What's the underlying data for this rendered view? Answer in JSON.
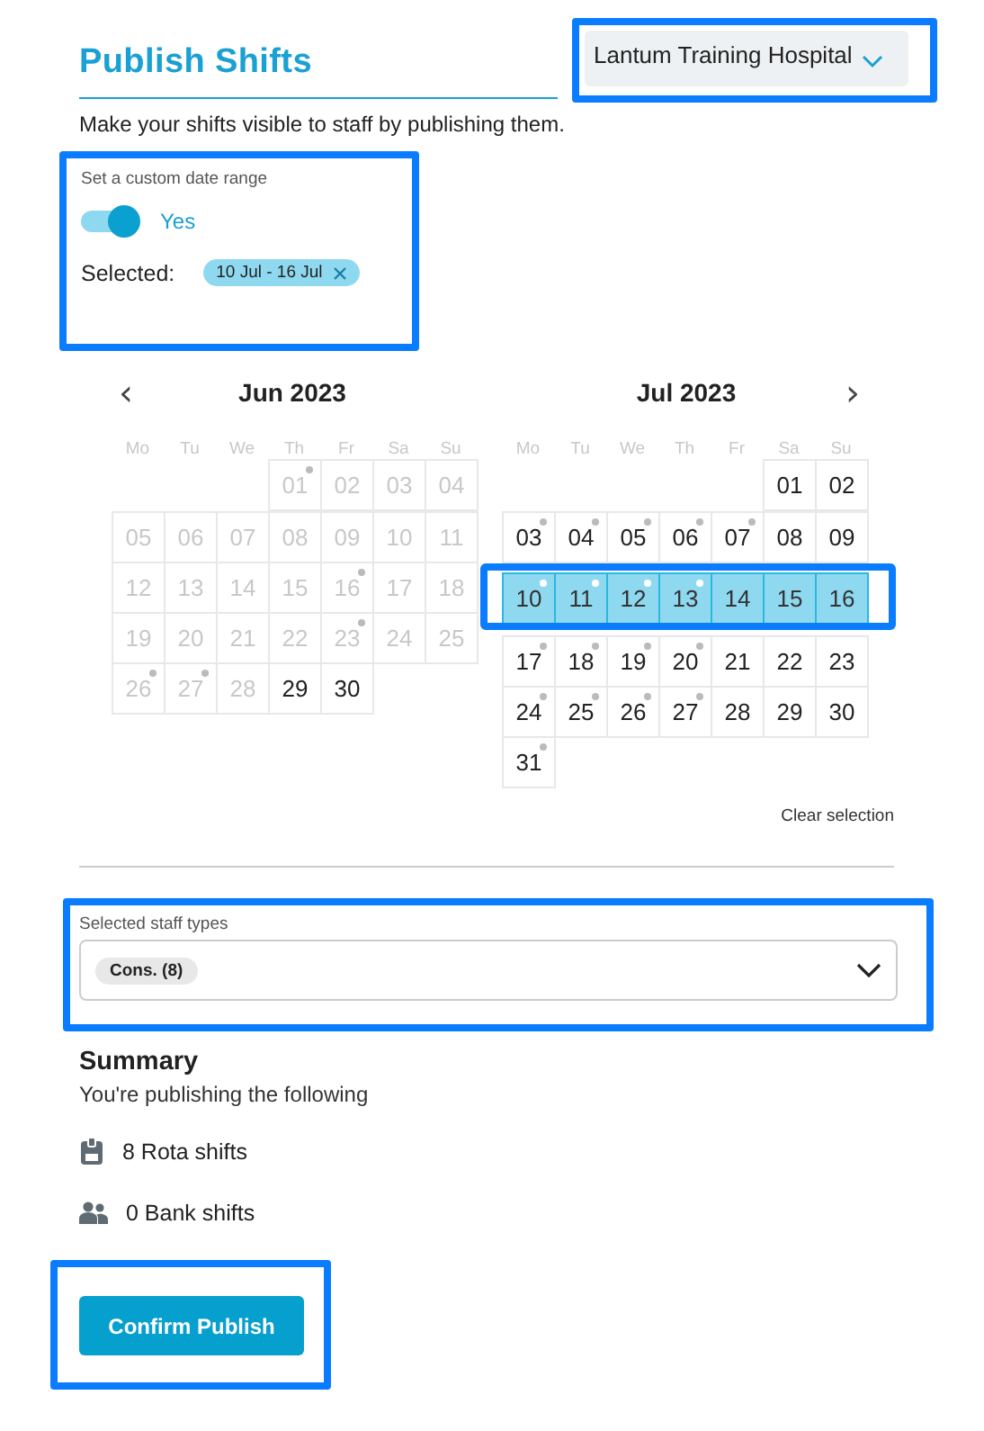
{
  "header": {
    "title": "Publish Shifts",
    "hospital": "Lantum Training Hospital",
    "subtitle": "Make your shifts visible to staff by publishing them."
  },
  "date_range": {
    "label": "Set a custom date range",
    "toggle": {
      "on": true,
      "label": "Yes"
    },
    "selected_label": "Selected:",
    "chip": "10 Jul - 16 Jul"
  },
  "calendar": {
    "prev": "‹",
    "next": "›",
    "clear": "Clear selection",
    "months": [
      {
        "title": "Jun 2023",
        "weekdays": [
          "Mo",
          "Tu",
          "We",
          "Th",
          "Fr",
          "Sa",
          "Su"
        ],
        "weeks": [
          [
            {
              "kind": "blank"
            },
            {
              "kind": "blank"
            },
            {
              "kind": "blank"
            },
            {
              "kind": "day",
              "label": "01",
              "disabled": true,
              "dot": true,
              "selected": false
            },
            {
              "kind": "day",
              "label": "02",
              "disabled": true,
              "dot": false,
              "selected": false
            },
            {
              "kind": "day",
              "label": "03",
              "disabled": true,
              "dot": false,
              "selected": false
            },
            {
              "kind": "day",
              "label": "04",
              "disabled": true,
              "dot": false,
              "selected": false
            }
          ],
          [
            {
              "kind": "day",
              "label": "05",
              "disabled": true,
              "dot": false,
              "selected": false
            },
            {
              "kind": "day",
              "label": "06",
              "disabled": true,
              "dot": false,
              "selected": false
            },
            {
              "kind": "day",
              "label": "07",
              "disabled": true,
              "dot": false,
              "selected": false
            },
            {
              "kind": "day",
              "label": "08",
              "disabled": true,
              "dot": false,
              "selected": false
            },
            {
              "kind": "day",
              "label": "09",
              "disabled": true,
              "dot": false,
              "selected": false
            },
            {
              "kind": "day",
              "label": "10",
              "disabled": true,
              "dot": false,
              "selected": false
            },
            {
              "kind": "day",
              "label": "11",
              "disabled": true,
              "dot": false,
              "selected": false
            }
          ],
          [
            {
              "kind": "day",
              "label": "12",
              "disabled": true,
              "dot": false,
              "selected": false
            },
            {
              "kind": "day",
              "label": "13",
              "disabled": true,
              "dot": false,
              "selected": false
            },
            {
              "kind": "day",
              "label": "14",
              "disabled": true,
              "dot": false,
              "selected": false
            },
            {
              "kind": "day",
              "label": "15",
              "disabled": true,
              "dot": false,
              "selected": false
            },
            {
              "kind": "day",
              "label": "16",
              "disabled": true,
              "dot": true,
              "selected": false
            },
            {
              "kind": "day",
              "label": "17",
              "disabled": true,
              "dot": false,
              "selected": false
            },
            {
              "kind": "day",
              "label": "18",
              "disabled": true,
              "dot": false,
              "selected": false
            }
          ],
          [
            {
              "kind": "day",
              "label": "19",
              "disabled": true,
              "dot": false,
              "selected": false
            },
            {
              "kind": "day",
              "label": "20",
              "disabled": true,
              "dot": false,
              "selected": false
            },
            {
              "kind": "day",
              "label": "21",
              "disabled": true,
              "dot": false,
              "selected": false
            },
            {
              "kind": "day",
              "label": "22",
              "disabled": true,
              "dot": false,
              "selected": false
            },
            {
              "kind": "day",
              "label": "23",
              "disabled": true,
              "dot": true,
              "selected": false
            },
            {
              "kind": "day",
              "label": "24",
              "disabled": true,
              "dot": false,
              "selected": false
            },
            {
              "kind": "day",
              "label": "25",
              "disabled": true,
              "dot": false,
              "selected": false
            }
          ],
          [
            {
              "kind": "day",
              "label": "26",
              "disabled": true,
              "dot": true,
              "selected": false
            },
            {
              "kind": "day",
              "label": "27",
              "disabled": true,
              "dot": true,
              "selected": false
            },
            {
              "kind": "day",
              "label": "28",
              "disabled": true,
              "dot": false,
              "selected": false
            },
            {
              "kind": "day",
              "label": "29",
              "disabled": false,
              "dot": false,
              "selected": false
            },
            {
              "kind": "day",
              "label": "30",
              "disabled": false,
              "dot": false,
              "selected": false
            },
            {
              "kind": "blank"
            },
            {
              "kind": "blank"
            }
          ]
        ]
      },
      {
        "title": "Jul 2023",
        "weekdays": [
          "Mo",
          "Tu",
          "We",
          "Th",
          "Fr",
          "Sa",
          "Su"
        ],
        "weeks": [
          [
            {
              "kind": "blank"
            },
            {
              "kind": "blank"
            },
            {
              "kind": "blank"
            },
            {
              "kind": "blank"
            },
            {
              "kind": "blank"
            },
            {
              "kind": "day",
              "label": "01",
              "disabled": false,
              "dot": false,
              "selected": false
            },
            {
              "kind": "day",
              "label": "02",
              "disabled": false,
              "dot": false,
              "selected": false
            }
          ],
          [
            {
              "kind": "day",
              "label": "03",
              "disabled": false,
              "dot": true,
              "selected": false
            },
            {
              "kind": "day",
              "label": "04",
              "disabled": false,
              "dot": true,
              "selected": false
            },
            {
              "kind": "day",
              "label": "05",
              "disabled": false,
              "dot": true,
              "selected": false
            },
            {
              "kind": "day",
              "label": "06",
              "disabled": false,
              "dot": true,
              "selected": false
            },
            {
              "kind": "day",
              "label": "07",
              "disabled": false,
              "dot": true,
              "selected": false
            },
            {
              "kind": "day",
              "label": "08",
              "disabled": false,
              "dot": false,
              "selected": false
            },
            {
              "kind": "day",
              "label": "09",
              "disabled": false,
              "dot": false,
              "selected": false
            }
          ],
          [
            {
              "kind": "day",
              "label": "10",
              "disabled": false,
              "dot": true,
              "selected": true
            },
            {
              "kind": "day",
              "label": "11",
              "disabled": false,
              "dot": true,
              "selected": true
            },
            {
              "kind": "day",
              "label": "12",
              "disabled": false,
              "dot": true,
              "selected": true
            },
            {
              "kind": "day",
              "label": "13",
              "disabled": false,
              "dot": true,
              "selected": true
            },
            {
              "kind": "day",
              "label": "14",
              "disabled": false,
              "dot": false,
              "selected": true
            },
            {
              "kind": "day",
              "label": "15",
              "disabled": false,
              "dot": false,
              "selected": true
            },
            {
              "kind": "day",
              "label": "16",
              "disabled": false,
              "dot": false,
              "selected": true
            }
          ],
          [
            {
              "kind": "day",
              "label": "17",
              "disabled": false,
              "dot": true,
              "selected": false
            },
            {
              "kind": "day",
              "label": "18",
              "disabled": false,
              "dot": true,
              "selected": false
            },
            {
              "kind": "day",
              "label": "19",
              "disabled": false,
              "dot": true,
              "selected": false
            },
            {
              "kind": "day",
              "label": "20",
              "disabled": false,
              "dot": true,
              "selected": false
            },
            {
              "kind": "day",
              "label": "21",
              "disabled": false,
              "dot": false,
              "selected": false
            },
            {
              "kind": "day",
              "label": "22",
              "disabled": false,
              "dot": false,
              "selected": false
            },
            {
              "kind": "day",
              "label": "23",
              "disabled": false,
              "dot": false,
              "selected": false
            }
          ],
          [
            {
              "kind": "day",
              "label": "24",
              "disabled": false,
              "dot": true,
              "selected": false
            },
            {
              "kind": "day",
              "label": "25",
              "disabled": false,
              "dot": true,
              "selected": false
            },
            {
              "kind": "day",
              "label": "26",
              "disabled": false,
              "dot": true,
              "selected": false
            },
            {
              "kind": "day",
              "label": "27",
              "disabled": false,
              "dot": true,
              "selected": false
            },
            {
              "kind": "day",
              "label": "28",
              "disabled": false,
              "dot": false,
              "selected": false
            },
            {
              "kind": "day",
              "label": "29",
              "disabled": false,
              "dot": false,
              "selected": false
            },
            {
              "kind": "day",
              "label": "30",
              "disabled": false,
              "dot": false,
              "selected": false
            }
          ],
          [
            {
              "kind": "day",
              "label": "31",
              "disabled": false,
              "dot": true,
              "selected": false
            },
            {
              "kind": "blank"
            },
            {
              "kind": "blank"
            },
            {
              "kind": "blank"
            },
            {
              "kind": "blank"
            },
            {
              "kind": "blank"
            },
            {
              "kind": "blank"
            }
          ]
        ]
      }
    ]
  },
  "staff_types": {
    "label": "Selected staff types",
    "chips": [
      "Cons. (8)"
    ]
  },
  "summary": {
    "title": "Summary",
    "subtitle": "You're publishing the following",
    "items": [
      {
        "kind": "rota",
        "text": "8 Rota shifts"
      },
      {
        "kind": "bank",
        "text": "0 Bank shifts"
      }
    ]
  },
  "confirm_button": "Confirm Publish"
}
